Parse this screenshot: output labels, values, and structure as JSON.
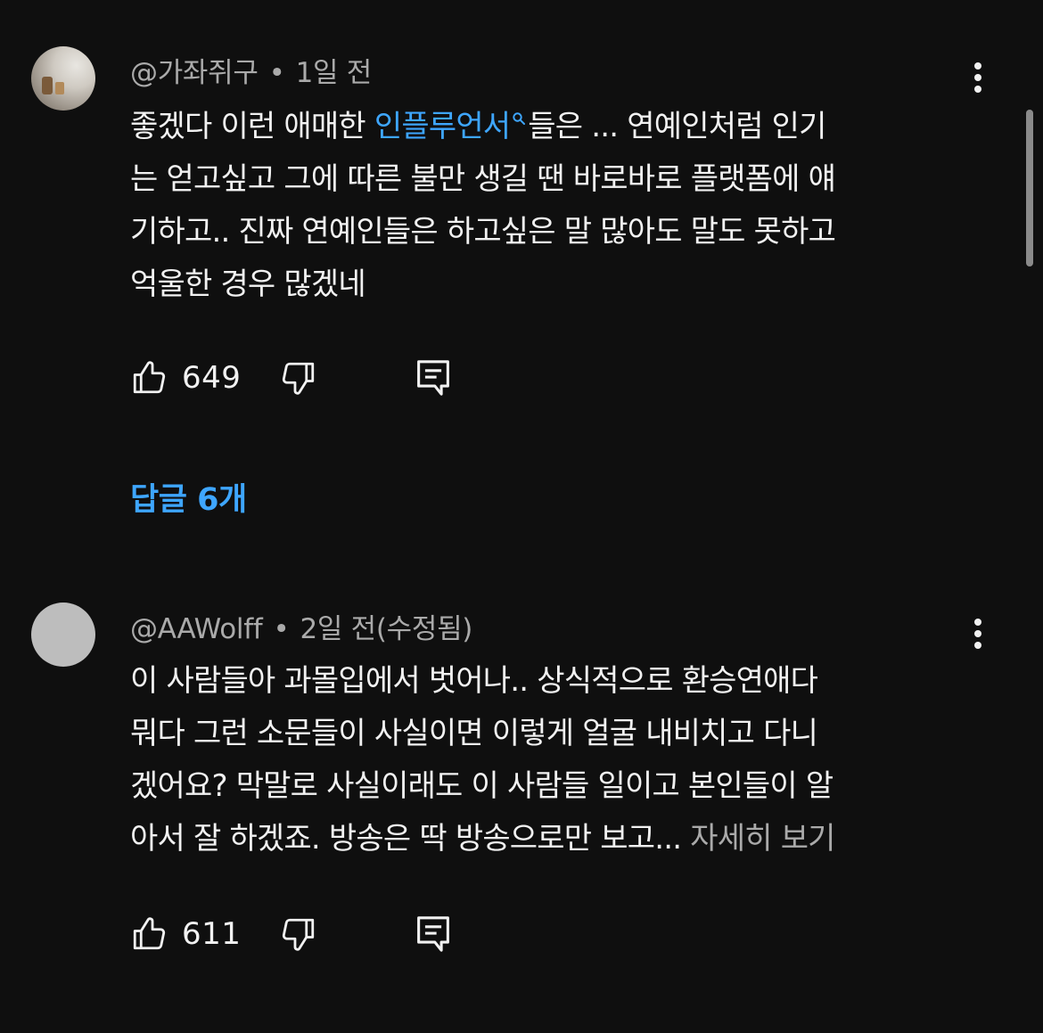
{
  "comments": [
    {
      "author": "@가좌쥐구",
      "separator": "•",
      "time": "1일 전",
      "avatar_icon": "user-avatar-photo",
      "menu_icon": "more-vert-icon",
      "text_lines": [
        {
          "before": "좋겠다 이런 애매한 ",
          "link": "인플루언서",
          "after": "들은 ... 연예인처럼 인기"
        },
        {
          "text": "는 얻고싶고 그에 따른 불만 생길 땐 바로바로 플랫폼에 얘"
        },
        {
          "text": "기하고.. 진짜 연예인들은 하고싶은 말 많아도 말도 못하고"
        },
        {
          "text": "억울한 경우 많겠네"
        }
      ],
      "link_icon": "search-icon",
      "likes": "649",
      "replies_label": "답글 6개"
    },
    {
      "author": "@AAWolff",
      "separator": "•",
      "time": "2일 전(수정됨)",
      "avatar_icon": "user-avatar-placeholder",
      "menu_icon": "more-vert-icon",
      "text_lines": [
        {
          "text": "이 사람들아 과몰입에서 벗어나.. 상식적으로 환승연애다"
        },
        {
          "text": "뭐다 그런 소문들이 사실이면 이렇게 얼굴 내비치고 다니"
        },
        {
          "text": "겠어요? 막말로 사실이래도 이 사람들 일이고 본인들이 알"
        },
        {
          "before": "아서 잘 하겠죠. 방송은 딱 방송으로만 보고... ",
          "more": "자세히 보기"
        }
      ],
      "likes": "611"
    }
  ],
  "colors": {
    "background": "#0f0f0f",
    "text": "#f1f1f1",
    "secondary": "#aaaaaa",
    "link": "#3ea6ff"
  }
}
